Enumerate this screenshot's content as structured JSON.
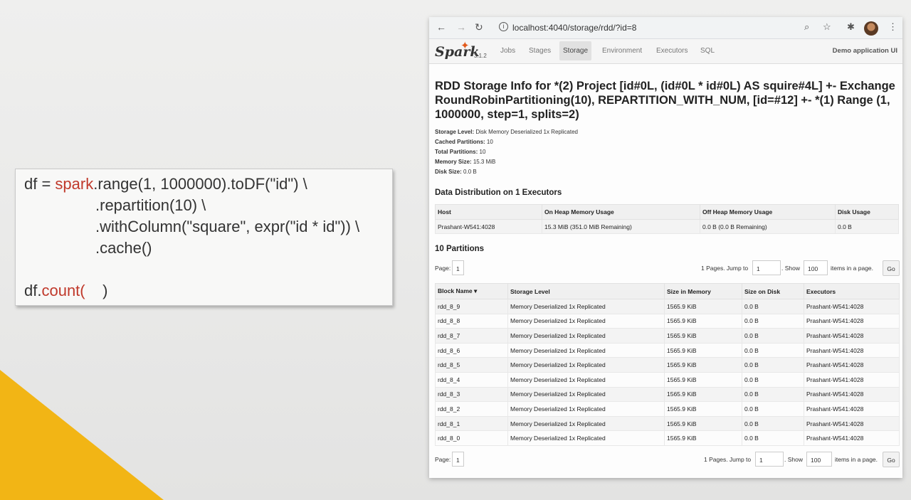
{
  "code": {
    "line1_var": "df = ",
    "line1_spark": "spark",
    "line1_rest": ".range(1, 1000000).toDF(\"id\") \\",
    "line2": ".repartition(10) \\",
    "line3": ".withColumn(\"square\", expr(\"id * id\")) \\",
    "line4": ".cache()",
    "line5_var": "df.",
    "line5_fn": "count(",
    "line5_end": "    )"
  },
  "browser": {
    "url": "localhost:4040/storage/rdd/?id=8",
    "back_icon": "arrow-left-icon",
    "forward_icon": "arrow-right-icon",
    "reload_icon": "reload-icon"
  },
  "nav": {
    "logo": "Spark",
    "version": "3.1.2",
    "items": [
      "Jobs",
      "Stages",
      "Storage",
      "Environment",
      "Executors",
      "SQL"
    ],
    "active": "Storage",
    "app_name": "Demo application UI"
  },
  "page": {
    "title": "RDD Storage Info for *(2) Project [id#0L, (id#0L * id#0L) AS squire#4L] +- Exchange RoundRobinPartitioning(10), REPARTITION_WITH_NUM, [id=#12] +- *(1) Range (1, 1000000, step=1, splits=2)",
    "info": [
      {
        "label": "Storage Level:",
        "value": "Disk Memory Deserialized 1x Replicated"
      },
      {
        "label": "Cached Partitions:",
        "value": "10"
      },
      {
        "label": "Total Partitions:",
        "value": "10"
      },
      {
        "label": "Memory Size:",
        "value": "15.3 MiB"
      },
      {
        "label": "Disk Size:",
        "value": "0.0 B"
      }
    ],
    "dist_heading": "Data Distribution on 1 Executors",
    "dist_headers": [
      "Host",
      "On Heap Memory Usage",
      "Off Heap Memory Usage",
      "Disk Usage"
    ],
    "dist_row": [
      "Prashant-W541:4028",
      "15.3 MiB (351.0 MiB Remaining)",
      "0.0 B (0.0 B Remaining)",
      "0.0 B"
    ],
    "part_heading": "10 Partitions",
    "pager": {
      "page_label": "Page:",
      "page_value": "1",
      "pages_text": "1 Pages. Jump to",
      "jump_value": "1",
      "show_text": ". Show",
      "show_value": "100",
      "items_text": "items in a page.",
      "go": "Go"
    },
    "blk_headers": [
      "Block Name ▾",
      "Storage Level",
      "Size in Memory",
      "Size on Disk",
      "Executors"
    ],
    "blk_rows": [
      [
        "rdd_8_9",
        "Memory Deserialized 1x Replicated",
        "1565.9 KiB",
        "0.0 B",
        "Prashant-W541:4028"
      ],
      [
        "rdd_8_8",
        "Memory Deserialized 1x Replicated",
        "1565.9 KiB",
        "0.0 B",
        "Prashant-W541:4028"
      ],
      [
        "rdd_8_7",
        "Memory Deserialized 1x Replicated",
        "1565.9 KiB",
        "0.0 B",
        "Prashant-W541:4028"
      ],
      [
        "rdd_8_6",
        "Memory Deserialized 1x Replicated",
        "1565.9 KiB",
        "0.0 B",
        "Prashant-W541:4028"
      ],
      [
        "rdd_8_5",
        "Memory Deserialized 1x Replicated",
        "1565.9 KiB",
        "0.0 B",
        "Prashant-W541:4028"
      ],
      [
        "rdd_8_4",
        "Memory Deserialized 1x Replicated",
        "1565.9 KiB",
        "0.0 B",
        "Prashant-W541:4028"
      ],
      [
        "rdd_8_3",
        "Memory Deserialized 1x Replicated",
        "1565.9 KiB",
        "0.0 B",
        "Prashant-W541:4028"
      ],
      [
        "rdd_8_2",
        "Memory Deserialized 1x Replicated",
        "1565.9 KiB",
        "0.0 B",
        "Prashant-W541:4028"
      ],
      [
        "rdd_8_1",
        "Memory Deserialized 1x Replicated",
        "1565.9 KiB",
        "0.0 B",
        "Prashant-W541:4028"
      ],
      [
        "rdd_8_0",
        "Memory Deserialized 1x Replicated",
        "1565.9 KiB",
        "0.0 B",
        "Prashant-W541:4028"
      ]
    ]
  }
}
